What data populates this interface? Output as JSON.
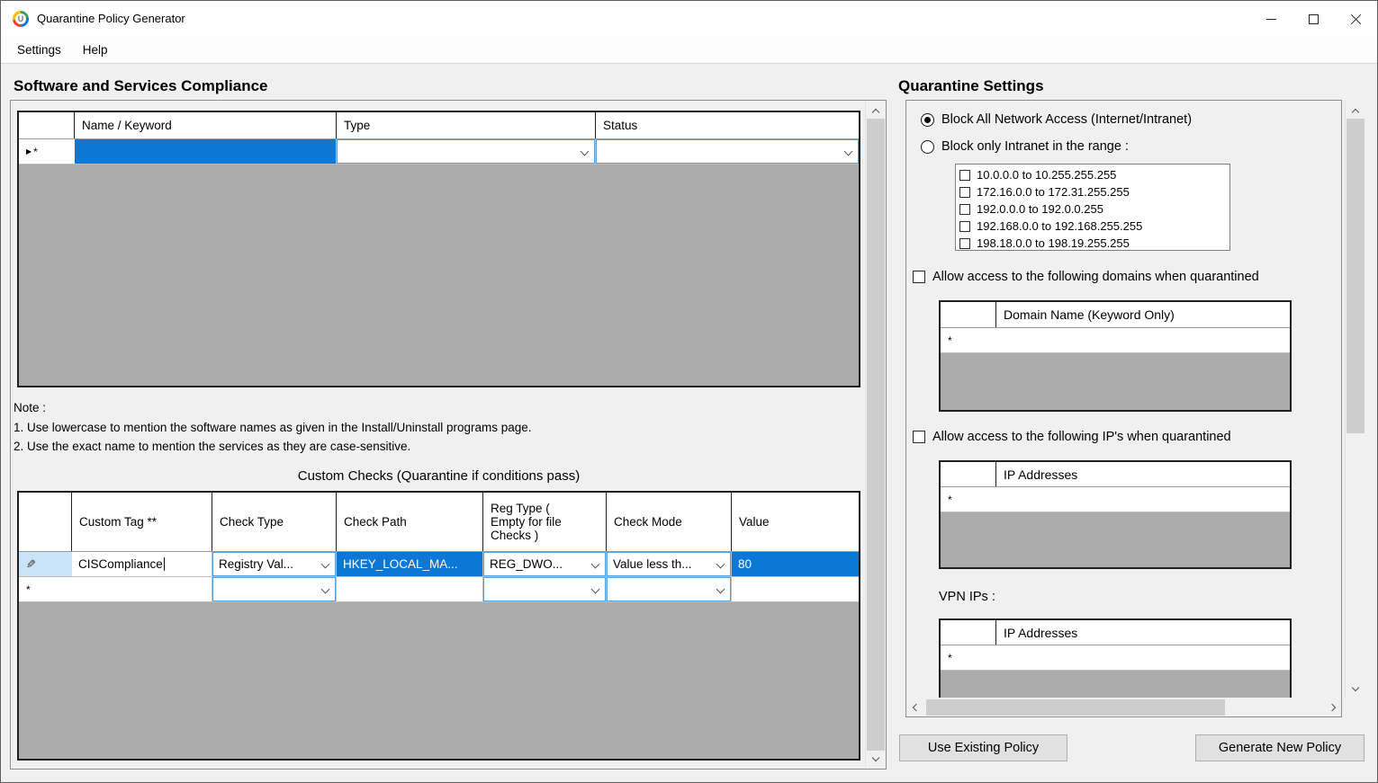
{
  "window": {
    "title": "Quarantine Policy Generator"
  },
  "menu": {
    "settings": "Settings",
    "help": "Help"
  },
  "icons": {
    "edit_pencil": "✎",
    "new_row": "*",
    "current_row": "▶"
  },
  "colors": {
    "selection_blue": "#0c77d4",
    "grid_gray": "#ababab",
    "edit_row_header_blue": "#cbe3f7"
  },
  "left": {
    "heading": "Software and Services Compliance",
    "software_grid": {
      "headers": [
        "Name / Keyword",
        "Type",
        "Status"
      ]
    },
    "note": {
      "label": "Note :",
      "lines": [
        "1. Use lowercase to mention the software names as given in the Install/Uninstall programs page.",
        "2. Use the exact name to mention the services as they are case-sensitive."
      ]
    },
    "custom_checks": {
      "title": "Custom Checks (Quarantine if conditions pass)",
      "headers": [
        "Custom Tag **",
        "Check Type",
        "Check Path",
        "Reg Type (\nEmpty for file\nChecks )",
        "Check Mode",
        "Value"
      ],
      "rows": [
        {
          "custom_tag": "CISCompliance",
          "check_type": "Registry Val...",
          "check_path": "HKEY_LOCAL_MA...",
          "reg_type": "REG_DWO...",
          "check_mode": "Value less th...",
          "value": "80"
        }
      ]
    }
  },
  "right": {
    "heading": "Quarantine Settings",
    "radios": [
      {
        "label": "Block All Network Access (Internet/Intranet)",
        "selected": true
      },
      {
        "label": "Block only Intranet in the range :",
        "selected": false
      }
    ],
    "ip_ranges": [
      "10.0.0.0 to 10.255.255.255",
      "172.16.0.0 to 172.31.255.255",
      "192.0.0.0 to 192.0.0.255",
      "192.168.0.0 to 192.168.255.255",
      "198.18.0.0 to 198.19.255.255"
    ],
    "allow_domains_label": "Allow access to the following domains when quarantined",
    "domain_grid": {
      "header": "Domain Name (Keyword Only)"
    },
    "allow_ips_label": "Allow access to the following IP's when quarantined",
    "ip_grid": {
      "header": "IP Addresses"
    },
    "vpn_label": "VPN IPs :",
    "vpn_grid": {
      "header": "IP Addresses"
    },
    "buttons": {
      "use_existing": "Use Existing Policy",
      "generate_new": "Generate New Policy"
    }
  }
}
